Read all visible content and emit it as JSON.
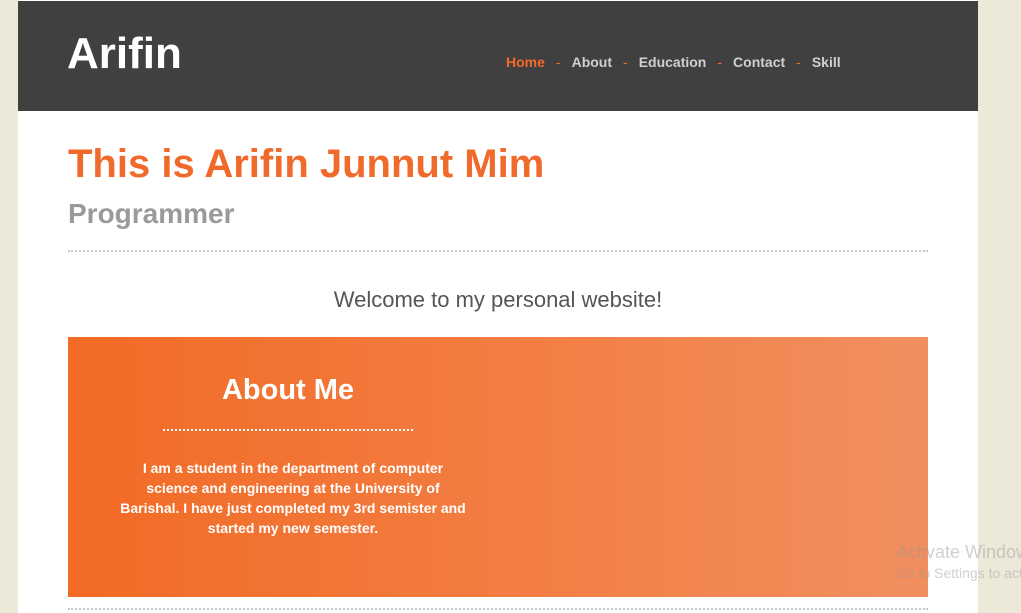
{
  "header": {
    "logo": "Arifin",
    "nav": [
      {
        "label": "Home",
        "active": true
      },
      {
        "label": "About",
        "active": false
      },
      {
        "label": "Education",
        "active": false
      },
      {
        "label": "Contact",
        "active": false
      },
      {
        "label": "Skill",
        "active": false
      }
    ],
    "separator": "-"
  },
  "main": {
    "title": "This is Arifin Junnut Mim",
    "subtitle": "Programmer",
    "welcome": "Welcome to my personal website!"
  },
  "about": {
    "title": "About Me",
    "text": "I am a student in the department of computer science and engineering at the University of Barishal. I have just completed my 3rd semister and started my new semester."
  },
  "watermark": {
    "line1": "Activate Windows",
    "line2": "Go to Settings to activate Windows."
  },
  "colors": {
    "accent": "#f26a2a",
    "header_bg": "#404040",
    "page_bg": "#ede9d9"
  }
}
